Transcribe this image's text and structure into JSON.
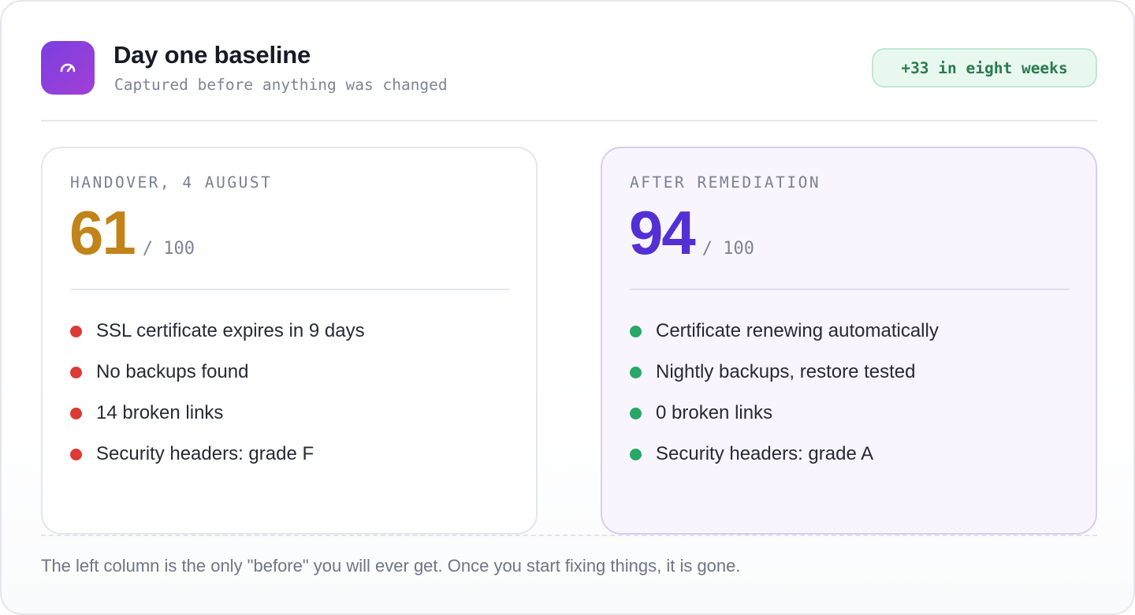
{
  "header": {
    "icon": "gauge-icon",
    "title": "Day one baseline",
    "subtitle": "Captured before anything was changed",
    "badge": "+33 in eight weeks"
  },
  "before": {
    "label": "HANDOVER, 4 AUGUST",
    "score": "61",
    "out_of": "/ 100",
    "score_color": "#c2841a",
    "items": [
      {
        "text": "SSL certificate expires in 9 days",
        "status": "bad"
      },
      {
        "text": "No backups found",
        "status": "bad"
      },
      {
        "text": "14 broken links",
        "status": "bad"
      },
      {
        "text": "Security headers: grade F",
        "status": "bad"
      }
    ]
  },
  "after": {
    "label": "AFTER REMEDIATION",
    "score": "94",
    "out_of": "/ 100",
    "score_color": "#5330d4",
    "items": [
      {
        "text": "Certificate renewing automatically",
        "status": "good"
      },
      {
        "text": "Nightly backups, restore tested",
        "status": "good"
      },
      {
        "text": "0 broken links",
        "status": "good"
      },
      {
        "text": "Security headers: grade A",
        "status": "good"
      }
    ]
  },
  "footer": "The left column is the only \"before\" you will ever get. Once you start fixing things, it is gone.",
  "colors": {
    "bad": "#dc3b35",
    "good": "#27a865",
    "accent": "#7b3fe0",
    "badge_bg": "#e8f8ef",
    "badge_text": "#2a7a4f"
  }
}
